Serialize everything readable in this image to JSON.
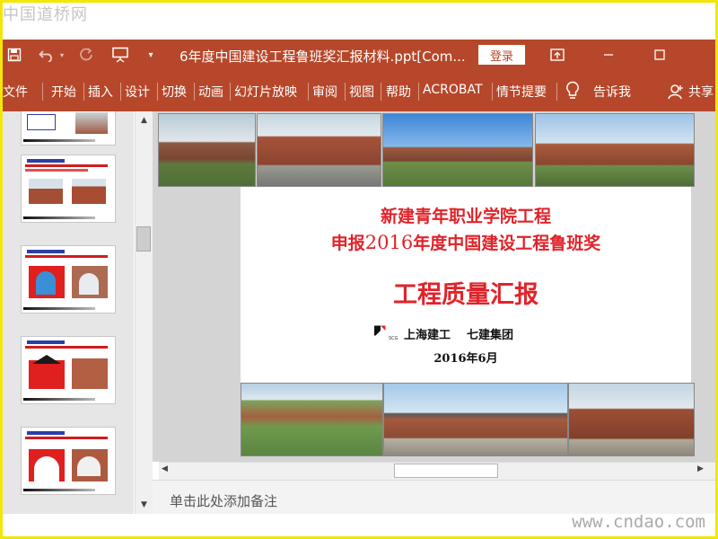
{
  "watermark": {
    "top": "中国道桥网",
    "bottom": "www.cndao.com"
  },
  "titlebar": {
    "doc_title": "6年度中国建设工程鲁班奖汇报材料.ppt[Com...",
    "login_label": "登录",
    "icons": [
      "save-icon",
      "undo-icon",
      "redo-icon",
      "present-icon",
      "customize-dropdown-icon",
      "ribbon-display-icon",
      "minimize-icon",
      "maximize-icon"
    ]
  },
  "ribbon": {
    "tabs": [
      "文件",
      "开始",
      "插入",
      "设计",
      "切换",
      "动画",
      "幻灯片放映",
      "审阅",
      "视图",
      "帮助",
      "ACROBAT",
      "情节提要"
    ],
    "tell_me": "告诉我",
    "share": "共享"
  },
  "slide": {
    "title_line1": "新建青年职业学院工程",
    "title_line2_pre": "申报",
    "title_line2_year": "2016",
    "title_line2_post": "年度中国建设工程鲁班奖",
    "main_title": "工程质量汇报",
    "org1": "上海建工",
    "org2": "七建集团",
    "logo_text": "SCG",
    "date": "2016年6月"
  },
  "notes": {
    "placeholder": "单击此处添加备注"
  },
  "colors": {
    "accent": "#b7472a",
    "slide_title": "#e0232a"
  }
}
